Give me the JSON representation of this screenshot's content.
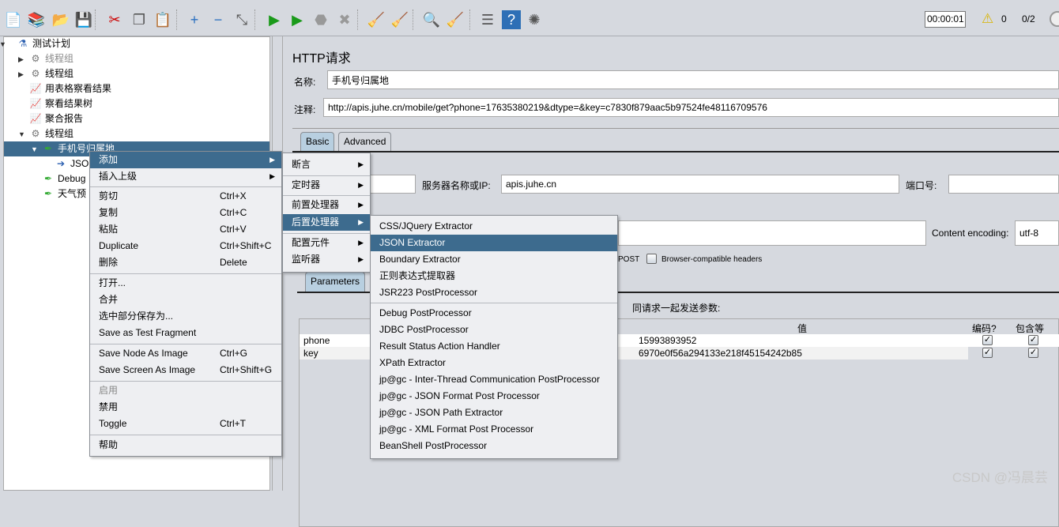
{
  "toolbar": {
    "icons": [
      "new-icon",
      "templates-icon",
      "open-icon",
      "save-icon",
      "cut-icon",
      "copy-icon",
      "paste-icon",
      "expand-icon",
      "collapse-icon",
      "toggle-icon",
      "start-icon",
      "start-no-pause-icon",
      "stop-icon",
      "shutdown-icon",
      "clear-icon",
      "clear-all-icon",
      "search-icon",
      "reset-search-icon",
      "function-helper-icon",
      "help-icon",
      "remote-icon"
    ],
    "timer": "00:00:01",
    "warnings": "0",
    "threads": "0/2"
  },
  "tree": {
    "items": [
      {
        "label": "测试计划",
        "icon": "test-plan-icon"
      },
      {
        "label": "线程组",
        "icon": "gear-icon",
        "disabled": true
      },
      {
        "label": "线程组",
        "icon": "gear-icon"
      },
      {
        "label": "用表格察看结果",
        "icon": "listener-icon"
      },
      {
        "label": "察看结果树",
        "icon": "listener-icon"
      },
      {
        "label": "聚合报告",
        "icon": "listener-icon"
      },
      {
        "label": "线程组",
        "icon": "gear-icon"
      },
      {
        "label": "手机号归属地",
        "icon": "sampler-icon"
      },
      {
        "label": "JSON",
        "icon": "post-processor-icon"
      },
      {
        "label": "Debug",
        "icon": "sampler-icon"
      },
      {
        "label": "天气预",
        "icon": "sampler-icon"
      }
    ]
  },
  "panel": {
    "title": "HTTP请求",
    "name_label": "名称:",
    "name_value": "手机号归属地",
    "comment_label": "注释:",
    "comment_value": "http://apis.juhe.cn/mobile/get?phone=17635380219&dtype=&key=c7830f879aac5b97524fe48116709576",
    "tabs": [
      "Basic",
      "Advanced"
    ],
    "server_label": "服务器名称或IP:",
    "server_value": "apis.juhe.cn",
    "port_label": "端口号:",
    "encoding_label": "Content encoding:",
    "encoding_value": "utf-8",
    "post_label": "POST",
    "browser_headers_label": "Browser-compatible headers",
    "param_tab": "Parameters",
    "send_params_label": "同请求一起发送参数:",
    "columns": [
      "值",
      "编码?",
      "包含等于?"
    ],
    "params": [
      {
        "name": "phone",
        "value": "15993893952",
        "encode": true,
        "include_equals": true
      },
      {
        "name": "key",
        "value": "6970e0f56a294133e218f45154242b85",
        "encode": true,
        "include_equals": true
      }
    ]
  },
  "context_menu": {
    "items": [
      {
        "label": "添加",
        "submenu": true,
        "selected": true
      },
      {
        "label": "插入上级",
        "submenu": true
      },
      {
        "label": "剪切",
        "shortcut": "Ctrl+X"
      },
      {
        "label": "复制",
        "shortcut": "Ctrl+C"
      },
      {
        "label": "粘贴",
        "shortcut": "Ctrl+V"
      },
      {
        "label": "Duplicate",
        "shortcut": "Ctrl+Shift+C"
      },
      {
        "label": "删除",
        "shortcut": "Delete"
      },
      {
        "label": "打开..."
      },
      {
        "label": "合并"
      },
      {
        "label": "选中部分保存为..."
      },
      {
        "label": "Save as Test Fragment"
      },
      {
        "label": "Save Node As Image",
        "shortcut": "Ctrl+G"
      },
      {
        "label": "Save Screen As Image",
        "shortcut": "Ctrl+Shift+G"
      },
      {
        "label": "启用",
        "disabled": true
      },
      {
        "label": "禁用"
      },
      {
        "label": "Toggle",
        "shortcut": "Ctrl+T"
      },
      {
        "label": "帮助"
      }
    ]
  },
  "add_submenu": {
    "items": [
      {
        "label": "断言"
      },
      {
        "label": "定时器"
      },
      {
        "label": "前置处理器"
      },
      {
        "label": "后置处理器",
        "selected": true
      },
      {
        "label": "配置元件"
      },
      {
        "label": "监听器"
      }
    ]
  },
  "post_submenu": {
    "items": [
      {
        "label": "CSS/JQuery Extractor"
      },
      {
        "label": "JSON Extractor",
        "selected": true
      },
      {
        "label": "Boundary Extractor"
      },
      {
        "label": "正则表达式提取器"
      },
      {
        "label": "JSR223 PostProcessor"
      },
      {
        "label": "Debug PostProcessor"
      },
      {
        "label": "JDBC PostProcessor"
      },
      {
        "label": "Result Status Action Handler"
      },
      {
        "label": "XPath Extractor"
      },
      {
        "label": "jp@gc - Inter-Thread Communication PostProcessor"
      },
      {
        "label": "jp@gc - JSON Format Post Processor"
      },
      {
        "label": "jp@gc - JSON Path Extractor"
      },
      {
        "label": "jp@gc - XML Format Post Processor"
      },
      {
        "label": "BeanShell PostProcessor"
      }
    ]
  },
  "watermark": "CSDN @冯晨芸",
  "colors": {
    "selection": "#3d6b8e",
    "background": "#d6d9df"
  }
}
